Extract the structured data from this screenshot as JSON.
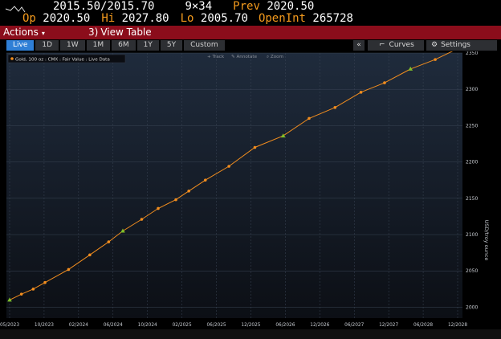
{
  "quote": {
    "bid_ask": "2015.50/2015.70",
    "size": "9×34",
    "prev_label": "Prev",
    "prev_value": "2020.50",
    "open_label": "Op",
    "open_value": "2020.50",
    "high_label": "Hi",
    "high_value": "2027.80",
    "low_label": "Lo",
    "low_value": "2005.70",
    "oi_label": "OpenInt",
    "oi_value": "265728"
  },
  "actionbar": {
    "actions_label": "Actions",
    "view_table_num": "3)",
    "view_table_label": "View Table"
  },
  "tabs": [
    {
      "label": "Live",
      "active": true
    },
    {
      "label": "1D"
    },
    {
      "label": "1W"
    },
    {
      "label": "1M"
    },
    {
      "label": "6M"
    },
    {
      "label": "1Y"
    },
    {
      "label": "5Y"
    },
    {
      "label": "Custom"
    }
  ],
  "right_tools": {
    "collapse_label": "«",
    "curves_label": "Curves",
    "settings_label": "Settings"
  },
  "chart_tools": {
    "track": "Track",
    "annotate": "Annotate",
    "zoom": "Zoom"
  },
  "legend": {
    "text": "Gold, 100 oz : CMX : Fair Value : Live Data"
  },
  "colors": {
    "line": "#f28d1e",
    "accent_marker": "#7fbf2a",
    "active_tab": "#2f7fd6",
    "actions_bar": "#8b0d1b",
    "quote_highlight": "#f39a1d"
  },
  "chart_data": {
    "type": "line",
    "title": "",
    "ylabel": "USD/troy ounce",
    "ylim": [
      1985,
      2350
    ],
    "y_ticks": [
      2000,
      2050,
      2100,
      2150,
      2200,
      2250,
      2300,
      2350
    ],
    "x_ticks": [
      "05/2023",
      "10/2023",
      "02/2024",
      "06/2024",
      "10/2024",
      "02/2025",
      "06/2025",
      "12/2025",
      "06/2026",
      "12/2026",
      "06/2027",
      "12/2027",
      "06/2028",
      "12/2028"
    ],
    "series": [
      {
        "x": [
          0,
          0.5,
          1,
          1.5,
          2.5,
          3.4,
          4.2,
          4.8,
          5.6,
          6.3,
          7.05,
          7.6,
          8.3,
          9.3,
          10.4,
          11.6,
          12.7,
          13.8,
          14.9,
          15.9,
          17,
          18.05,
          19
        ],
        "values": [
          2010,
          2018,
          2025,
          2034,
          2052,
          2072,
          2090,
          2105,
          2121,
          2136,
          2148,
          2160,
          2175,
          2194,
          2220,
          2236,
          2260,
          2275,
          2296,
          2309,
          2328,
          2341,
          2356
        ],
        "highlight_indices": [
          0,
          7,
          15,
          20,
          22
        ]
      }
    ]
  }
}
